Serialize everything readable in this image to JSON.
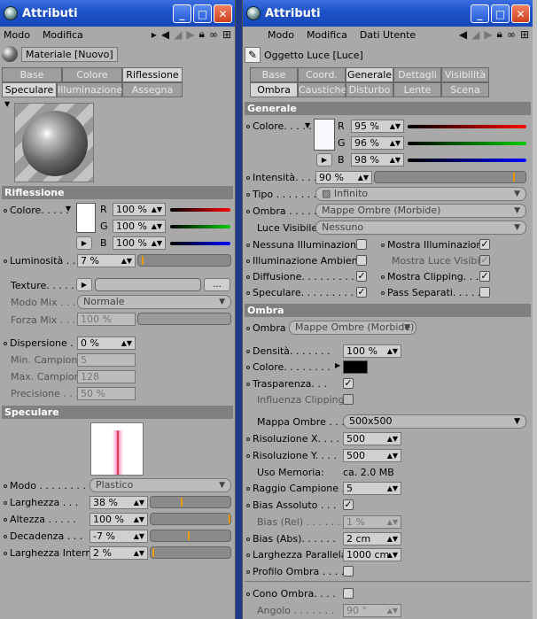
{
  "left": {
    "title": "Attributi",
    "menu": [
      "Modo",
      "Modifica"
    ],
    "object_name": "Materiale [Nuovo]",
    "tabs_row1": [
      "Base",
      "Colore",
      "Riflessione"
    ],
    "tabs_row2": [
      "Speculare",
      "Illuminazione",
      "Assegna"
    ],
    "sec_riflessione": "Riflessione",
    "colore_label": "Colore. . . . .",
    "r_label": "R",
    "g_label": "G",
    "b_label": "B",
    "r_val": "100 %",
    "g_val": "100 %",
    "b_val": "100 %",
    "lum_label": "Luminosità . .",
    "lum_val": "7 %",
    "texture_label": "Texture. . . . .",
    "texture_btn": "...",
    "modomix_label": "Modo Mix . . .",
    "modomix_val": "Normale",
    "forzamix_label": "Forza Mix . . .",
    "forzamix_val": "100 %",
    "disp_label": "Dispersione . .",
    "disp_val": "0 %",
    "mincamp_label": "Min. Campioni",
    "mincamp_val": "5",
    "maxcamp_label": "Max. Campioni",
    "maxcamp_val": "128",
    "prec_label": "Precisione . . .",
    "prec_val": "50 %",
    "sec_speculare": "Speculare",
    "modo_label": "Modo . . . . . . . .",
    "modo_val": "Plastico",
    "larg_label": "Larghezza . . .",
    "larg_val": "38 %",
    "alt_label": "Altezza . . . . .",
    "alt_val": "100 %",
    "dec_label": "Decadenza . . .",
    "dec_val": "-7 %",
    "largint_label": "Larghezza Interna",
    "largint_val": "2 %"
  },
  "right": {
    "title": "Attributi",
    "menu": [
      "Modo",
      "Modifica",
      "Dati Utente"
    ],
    "object_name": "Oggetto Luce [Luce]",
    "tabs_row1": [
      "Base",
      "Coord.",
      "Generale",
      "Dettagli",
      "Visibilità"
    ],
    "tabs_row2": [
      "Ombra",
      "Caustiche",
      "Disturbo",
      "Lente",
      "Scena"
    ],
    "sec_generale": "Generale",
    "colore_label": "Colore. . . . .",
    "r_label": "R",
    "g_label": "G",
    "b_label": "B",
    "r_val": "95 %",
    "g_val": "96 %",
    "b_val": "98 %",
    "int_label": "Intensità. . . .",
    "int_val": "90 %",
    "tipo_label": "Tipo . . . . . . .",
    "tipo_val": "Infinito",
    "ombra_label": "Ombra . . . . .",
    "ombra_val": "Mappe Ombre (Morbide)",
    "lucevis_label": "Luce Visibile",
    "lucevis_val": "Nessuno",
    "nessuna_label": "Nessuna Illuminazione",
    "mostrailluminazione_label": "Mostra Illuminazione",
    "illamb_label": "Illuminazione Ambiente",
    "mostraluce_label": "Mostra Luce Visibile",
    "diff_label": "Diffusione. . . . . . . . .",
    "mostraclip_label": "Mostra Clipping. . . .",
    "spec_label": "Speculare. . . . . . . . .",
    "passsep_label": "Pass Separati. . . . .",
    "sec_ombra": "Ombra",
    "ombra2_label": "Ombra",
    "ombra2_val": "Mappe Ombre (Morbide)",
    "dens_label": "Densità. . . . . . .",
    "dens_val": "100 %",
    "col2_label": "Colore. . . . . . . .",
    "trasp_label": "Trasparenza. . .",
    "inflclip_label": "Influenza Clipping",
    "mappa_label": "Mappa Ombre . . . . .",
    "mappa_val": "500x500",
    "risx_label": "Risoluzione X. . . .",
    "risx_val": "500",
    "risy_label": "Risoluzione Y. . . .",
    "risy_val": "500",
    "usomem_label": "Uso Memoria:",
    "usomem_val": "ca. 2.0 MB",
    "raggio_label": "Raggio Campione . .",
    "raggio_val": "5",
    "biasass_label": "Bias Assoluto . . .",
    "biasrel_label": "Bias (Rel) . . . . . .",
    "biasrel_val": "1 %",
    "biasabs_label": "Bias (Abs). . . . . .",
    "biasabs_val": "2 cm",
    "largpar_label": "Larghezza Parallela",
    "largpar_val": "1000 cm",
    "profilo_label": "Profilo Ombra . . . .",
    "cono_label": "Cono Ombra. . . .",
    "angolo_label": "Angolo . . . . . . .",
    "angolo_val": "90 °"
  }
}
